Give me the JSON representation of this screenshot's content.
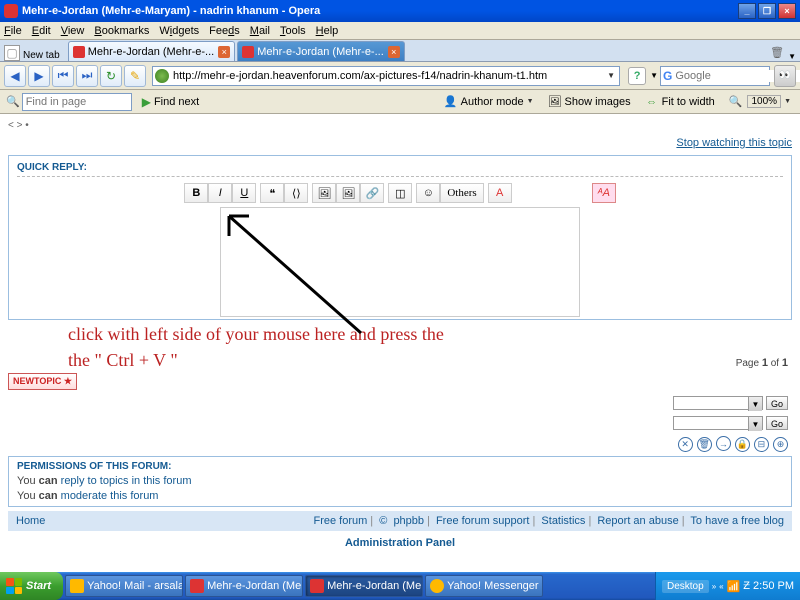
{
  "window": {
    "title": "Mehr-e-Jordan (Mehr-e-Maryam) - nadrin khanum - Opera",
    "min": "_",
    "max": "❐",
    "close": "×"
  },
  "menu": {
    "file": "File",
    "edit": "Edit",
    "view": "View",
    "bookmarks": "Bookmarks",
    "widgets": "Widgets",
    "feeds": "Feeds",
    "mail": "Mail",
    "tools": "Tools",
    "help": "Help"
  },
  "tabs": {
    "newtab_label": "New tab",
    "t1": "Mehr-e-Jordan (Mehr-e-...",
    "t2": "Mehr-e-Jordan (Mehr-e-..."
  },
  "url": "http://mehr-e-jordan.heavenforum.com/ax-pictures-f14/nadrin-khanum-t1.htm",
  "search": {
    "placeholder": "Google"
  },
  "findbar": {
    "placeholder": "Find in page",
    "findnext": "Find next",
    "authormode": "Author mode",
    "showimages": "Show images",
    "fit": "Fit to width",
    "zoom": "100%"
  },
  "page": {
    "crumb": "< > •",
    "stopwatch": "Stop watching this topic",
    "quickreply": "QUICK REPLY:",
    "others": "Others",
    "switch": "ᴬA",
    "instruction_l1": "click with left side of your mouse here and press the",
    "instruction_l2": "the \" Ctrl + V \"",
    "newtopic": "NEWTOPIC ★",
    "page_of": "Page 1 of 1",
    "go": "Go",
    "perms_title": "PERMISSIONS OF THIS FORUM:",
    "perms_l1_a": "You ",
    "perms_l1_b": "can",
    "perms_l1_c": " reply to topics in this forum",
    "perms_l2_a": "You ",
    "perms_l2_b": "can",
    "perms_l2_c": " moderate this forum",
    "home": "Home",
    "foot": {
      "free": "Free forum",
      "copy": "©",
      "phpbb": "phpbb",
      "support": "Free forum support",
      "stats": "Statistics",
      "abuse": "Report an abuse",
      "blog": "To have a free blog"
    },
    "admin": "Administration Panel"
  },
  "taskbar": {
    "start": "Start",
    "t1": "Yahoo! Mail - arsalanabd...",
    "t2": "Mehr-e-Jordan (Mehr-e-...",
    "t3": "Mehr-e-Jordan (Mehr...",
    "t4": "Yahoo! Messenger",
    "desktop": "Desktop",
    "time": "2:50 PM"
  }
}
